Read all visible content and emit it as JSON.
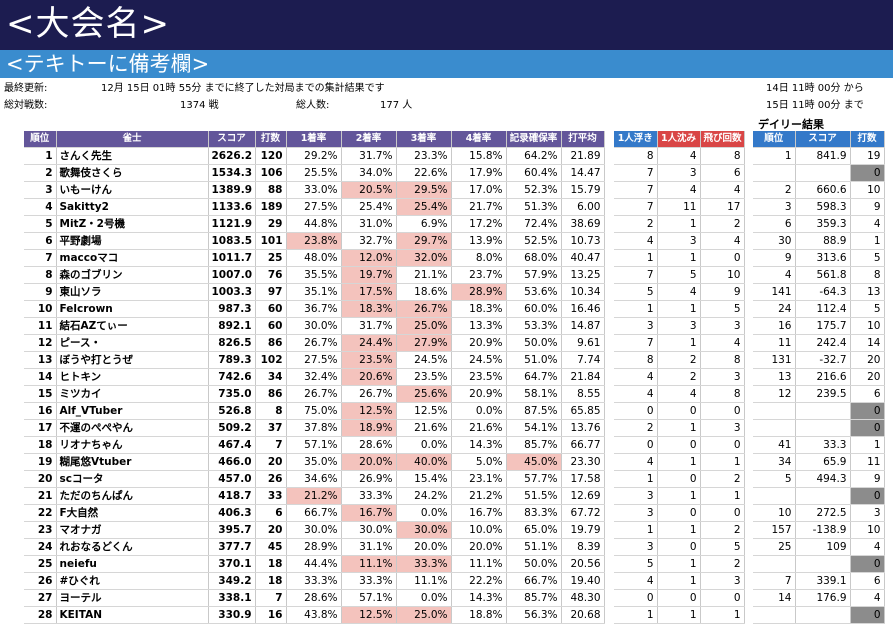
{
  "title": "<大会名>",
  "subtitle": "<テキトーに備考欄>",
  "info": {
    "last_update_label": "最終更新:",
    "last_update_value": "12月 15日 01時 55分 までに終了した対局までの集計結果です",
    "games_label": "総対戦数:",
    "games_value": "1374 戦",
    "players_label": "総人数:",
    "players_value": "177 人",
    "period_from": "14日 11時 00分 から",
    "period_to": "15日 11時 00分 まで",
    "daily_title": "デイリー結果"
  },
  "headers": {
    "main": [
      "順位",
      "雀士",
      "スコア",
      "打数",
      "1着率",
      "2着率",
      "3着率",
      "4着率",
      "記录確保率",
      "打平均"
    ],
    "mid": [
      "1人浮き",
      "1人沈み",
      "飛び回数"
    ],
    "daily": [
      "順位",
      "スコア",
      "打数"
    ]
  },
  "rows": [
    {
      "rank": "1",
      "name": "さんく先生",
      "score": "2626.2",
      "games": "120",
      "r1": "29.2%",
      "r2": "31.7%",
      "r3": "23.3%",
      "r4": "15.8%",
      "keep": "64.2%",
      "avg": "21.89",
      "up1": "8",
      "down1": "4",
      "tobi": "8",
      "d_rank": "1",
      "d_score": "841.9",
      "d_games": "19",
      "hl": []
    },
    {
      "rank": "2",
      "name": "歌舞伎さくら",
      "score": "1534.3",
      "games": "106",
      "r1": "25.5%",
      "r2": "34.0%",
      "r3": "22.6%",
      "r4": "17.9%",
      "keep": "60.4%",
      "avg": "14.47",
      "up1": "7",
      "down1": "3",
      "tobi": "6",
      "d_rank": "",
      "d_score": "",
      "d_games": "0",
      "hl": []
    },
    {
      "rank": "3",
      "name": "いもーけん",
      "score": "1389.9",
      "games": "88",
      "r1": "33.0%",
      "r2": "20.5%",
      "r3": "29.5%",
      "r4": "17.0%",
      "keep": "52.3%",
      "avg": "15.79",
      "up1": "7",
      "down1": "4",
      "tobi": "4",
      "d_rank": "2",
      "d_score": "660.6",
      "d_games": "10",
      "hl": [
        "r2",
        "r3"
      ]
    },
    {
      "rank": "4",
      "name": "Sakitty2",
      "score": "1133.6",
      "games": "189",
      "r1": "27.5%",
      "r2": "25.4%",
      "r3": "25.4%",
      "r4": "21.7%",
      "keep": "51.3%",
      "avg": "6.00",
      "up1": "7",
      "down1": "11",
      "tobi": "17",
      "d_rank": "3",
      "d_score": "598.3",
      "d_games": "9",
      "hl": [
        "r3"
      ]
    },
    {
      "rank": "5",
      "name": "MitZ・2号機",
      "score": "1121.9",
      "games": "29",
      "r1": "44.8%",
      "r2": "31.0%",
      "r3": "6.9%",
      "r4": "17.2%",
      "keep": "72.4%",
      "avg": "38.69",
      "up1": "2",
      "down1": "1",
      "tobi": "2",
      "d_rank": "6",
      "d_score": "359.3",
      "d_games": "4",
      "hl": []
    },
    {
      "rank": "6",
      "name": "平野劇場",
      "score": "1083.5",
      "games": "101",
      "r1": "23.8%",
      "r2": "32.7%",
      "r3": "29.7%",
      "r4": "13.9%",
      "keep": "52.5%",
      "avg": "10.73",
      "up1": "4",
      "down1": "3",
      "tobi": "4",
      "d_rank": "30",
      "d_score": "88.9",
      "d_games": "1",
      "hl": [
        "r1",
        "r3"
      ]
    },
    {
      "rank": "7",
      "name": "maccoマコ",
      "score": "1011.7",
      "games": "25",
      "r1": "48.0%",
      "r2": "12.0%",
      "r3": "32.0%",
      "r4": "8.0%",
      "keep": "68.0%",
      "avg": "40.47",
      "up1": "1",
      "down1": "1",
      "tobi": "0",
      "d_rank": "9",
      "d_score": "313.6",
      "d_games": "5",
      "hl": [
        "r2",
        "r3"
      ]
    },
    {
      "rank": "8",
      "name": "森のゴブリン",
      "score": "1007.0",
      "games": "76",
      "r1": "35.5%",
      "r2": "19.7%",
      "r3": "21.1%",
      "r4": "23.7%",
      "keep": "57.9%",
      "avg": "13.25",
      "up1": "7",
      "down1": "5",
      "tobi": "10",
      "d_rank": "4",
      "d_score": "561.8",
      "d_games": "8",
      "hl": [
        "r2"
      ]
    },
    {
      "rank": "9",
      "name": "東山ソラ",
      "score": "1003.3",
      "games": "97",
      "r1": "35.1%",
      "r2": "17.5%",
      "r3": "18.6%",
      "r4": "28.9%",
      "keep": "53.6%",
      "avg": "10.34",
      "up1": "5",
      "down1": "4",
      "tobi": "9",
      "d_rank": "141",
      "d_score": "-64.3",
      "d_games": "13",
      "hl": [
        "r2",
        "r4"
      ]
    },
    {
      "rank": "10",
      "name": "Felcrown",
      "score": "987.3",
      "games": "60",
      "r1": "36.7%",
      "r2": "18.3%",
      "r3": "26.7%",
      "r4": "18.3%",
      "keep": "60.0%",
      "avg": "16.46",
      "up1": "1",
      "down1": "1",
      "tobi": "5",
      "d_rank": "24",
      "d_score": "112.4",
      "d_games": "5",
      "hl": [
        "r2",
        "r3"
      ]
    },
    {
      "rank": "11",
      "name": "結石AZてぃー",
      "score": "892.1",
      "games": "60",
      "r1": "30.0%",
      "r2": "31.7%",
      "r3": "25.0%",
      "r4": "13.3%",
      "keep": "53.3%",
      "avg": "14.87",
      "up1": "3",
      "down1": "3",
      "tobi": "3",
      "d_rank": "16",
      "d_score": "175.7",
      "d_games": "10",
      "hl": [
        "r3"
      ]
    },
    {
      "rank": "12",
      "name": "ピース・",
      "score": "826.5",
      "games": "86",
      "r1": "26.7%",
      "r2": "24.4%",
      "r3": "27.9%",
      "r4": "20.9%",
      "keep": "50.0%",
      "avg": "9.61",
      "up1": "7",
      "down1": "1",
      "tobi": "4",
      "d_rank": "11",
      "d_score": "242.4",
      "d_games": "14",
      "hl": [
        "r2",
        "r3"
      ]
    },
    {
      "rank": "13",
      "name": "ぼうや打とうぜ",
      "score": "789.3",
      "games": "102",
      "r1": "27.5%",
      "r2": "23.5%",
      "r3": "24.5%",
      "r4": "24.5%",
      "keep": "51.0%",
      "avg": "7.74",
      "up1": "8",
      "down1": "2",
      "tobi": "8",
      "d_rank": "131",
      "d_score": "-32.7",
      "d_games": "20",
      "hl": [
        "r2"
      ]
    },
    {
      "rank": "14",
      "name": "ヒトキン",
      "score": "742.6",
      "games": "34",
      "r1": "32.4%",
      "r2": "20.6%",
      "r3": "23.5%",
      "r4": "23.5%",
      "keep": "64.7%",
      "avg": "21.84",
      "up1": "4",
      "down1": "2",
      "tobi": "3",
      "d_rank": "13",
      "d_score": "216.6",
      "d_games": "20",
      "hl": [
        "r2"
      ]
    },
    {
      "rank": "15",
      "name": "ミツカイ",
      "score": "735.0",
      "games": "86",
      "r1": "26.7%",
      "r2": "26.7%",
      "r3": "25.6%",
      "r4": "20.9%",
      "keep": "58.1%",
      "avg": "8.55",
      "up1": "4",
      "down1": "4",
      "tobi": "8",
      "d_rank": "12",
      "d_score": "239.5",
      "d_games": "6",
      "hl": [
        "r3"
      ]
    },
    {
      "rank": "16",
      "name": "Alf_VTuber",
      "score": "526.8",
      "games": "8",
      "r1": "75.0%",
      "r2": "12.5%",
      "r3": "12.5%",
      "r4": "0.0%",
      "keep": "87.5%",
      "avg": "65.85",
      "up1": "0",
      "down1": "0",
      "tobi": "0",
      "d_rank": "",
      "d_score": "",
      "d_games": "0",
      "hl": [
        "r2"
      ]
    },
    {
      "rank": "17",
      "name": "不運のぺぺやん",
      "score": "509.2",
      "games": "37",
      "r1": "37.8%",
      "r2": "18.9%",
      "r3": "21.6%",
      "r4": "21.6%",
      "keep": "54.1%",
      "avg": "13.76",
      "up1": "2",
      "down1": "1",
      "tobi": "3",
      "d_rank": "",
      "d_score": "",
      "d_games": "0",
      "hl": [
        "r2"
      ]
    },
    {
      "rank": "18",
      "name": "リオナちゃん",
      "score": "467.4",
      "games": "7",
      "r1": "57.1%",
      "r2": "28.6%",
      "r3": "0.0%",
      "r4": "14.3%",
      "keep": "85.7%",
      "avg": "66.77",
      "up1": "0",
      "down1": "0",
      "tobi": "0",
      "d_rank": "41",
      "d_score": "33.3",
      "d_games": "1",
      "hl": []
    },
    {
      "rank": "19",
      "name": "糊尾悠Vtuber",
      "score": "466.0",
      "games": "20",
      "r1": "35.0%",
      "r2": "20.0%",
      "r3": "40.0%",
      "r4": "5.0%",
      "keep": "45.0%",
      "avg": "23.30",
      "up1": "4",
      "down1": "1",
      "tobi": "1",
      "d_rank": "34",
      "d_score": "65.9",
      "d_games": "11",
      "hl": [
        "r2",
        "r3",
        "keep"
      ]
    },
    {
      "rank": "20",
      "name": "scコータ",
      "score": "457.0",
      "games": "26",
      "r1": "34.6%",
      "r2": "26.9%",
      "r3": "15.4%",
      "r4": "23.1%",
      "keep": "57.7%",
      "avg": "17.58",
      "up1": "1",
      "down1": "0",
      "tobi": "2",
      "d_rank": "5",
      "d_score": "494.3",
      "d_games": "9",
      "hl": []
    },
    {
      "rank": "21",
      "name": "ただのちんぱん",
      "score": "418.7",
      "games": "33",
      "r1": "21.2%",
      "r2": "33.3%",
      "r3": "24.2%",
      "r4": "21.2%",
      "keep": "51.5%",
      "avg": "12.69",
      "up1": "3",
      "down1": "1",
      "tobi": "1",
      "d_rank": "",
      "d_score": "",
      "d_games": "0",
      "hl": [
        "r1"
      ]
    },
    {
      "rank": "22",
      "name": "F大自然",
      "score": "406.3",
      "games": "6",
      "r1": "66.7%",
      "r2": "16.7%",
      "r3": "0.0%",
      "r4": "16.7%",
      "keep": "83.3%",
      "avg": "67.72",
      "up1": "3",
      "down1": "0",
      "tobi": "0",
      "d_rank": "10",
      "d_score": "272.5",
      "d_games": "3",
      "hl": [
        "r2"
      ]
    },
    {
      "rank": "23",
      "name": "マオナガ",
      "score": "395.7",
      "games": "20",
      "r1": "30.0%",
      "r2": "30.0%",
      "r3": "30.0%",
      "r4": "10.0%",
      "keep": "65.0%",
      "avg": "19.79",
      "up1": "1",
      "down1": "1",
      "tobi": "2",
      "d_rank": "157",
      "d_score": "-138.9",
      "d_games": "10",
      "hl": [
        "r3"
      ]
    },
    {
      "rank": "24",
      "name": "れおなるどくん",
      "score": "377.7",
      "games": "45",
      "r1": "28.9%",
      "r2": "31.1%",
      "r3": "20.0%",
      "r4": "20.0%",
      "keep": "51.1%",
      "avg": "8.39",
      "up1": "3",
      "down1": "0",
      "tobi": "5",
      "d_rank": "25",
      "d_score": "109",
      "d_games": "4",
      "hl": []
    },
    {
      "rank": "25",
      "name": "neiefu",
      "score": "370.1",
      "games": "18",
      "r1": "44.4%",
      "r2": "11.1%",
      "r3": "33.3%",
      "r4": "11.1%",
      "keep": "50.0%",
      "avg": "20.56",
      "up1": "5",
      "down1": "1",
      "tobi": "2",
      "d_rank": "",
      "d_score": "",
      "d_games": "0",
      "hl": [
        "r2",
        "r3"
      ]
    },
    {
      "rank": "26",
      "name": "#ひぐれ",
      "score": "349.2",
      "games": "18",
      "r1": "33.3%",
      "r2": "33.3%",
      "r3": "11.1%",
      "r4": "22.2%",
      "keep": "66.7%",
      "avg": "19.40",
      "up1": "4",
      "down1": "1",
      "tobi": "3",
      "d_rank": "7",
      "d_score": "339.1",
      "d_games": "6",
      "hl": []
    },
    {
      "rank": "27",
      "name": "ヨーテル",
      "score": "338.1",
      "games": "7",
      "r1": "28.6%",
      "r2": "57.1%",
      "r3": "0.0%",
      "r4": "14.3%",
      "keep": "85.7%",
      "avg": "48.30",
      "up1": "0",
      "down1": "0",
      "tobi": "0",
      "d_rank": "14",
      "d_score": "176.9",
      "d_games": "4",
      "hl": []
    },
    {
      "rank": "28",
      "name": "KEITAN",
      "score": "330.9",
      "games": "16",
      "r1": "43.8%",
      "r2": "12.5%",
      "r3": "25.0%",
      "r4": "18.8%",
      "keep": "56.3%",
      "avg": "20.68",
      "up1": "1",
      "down1": "1",
      "tobi": "1",
      "d_rank": "",
      "d_score": "",
      "d_games": "0",
      "hl": [
        "r2",
        "r3"
      ]
    }
  ]
}
